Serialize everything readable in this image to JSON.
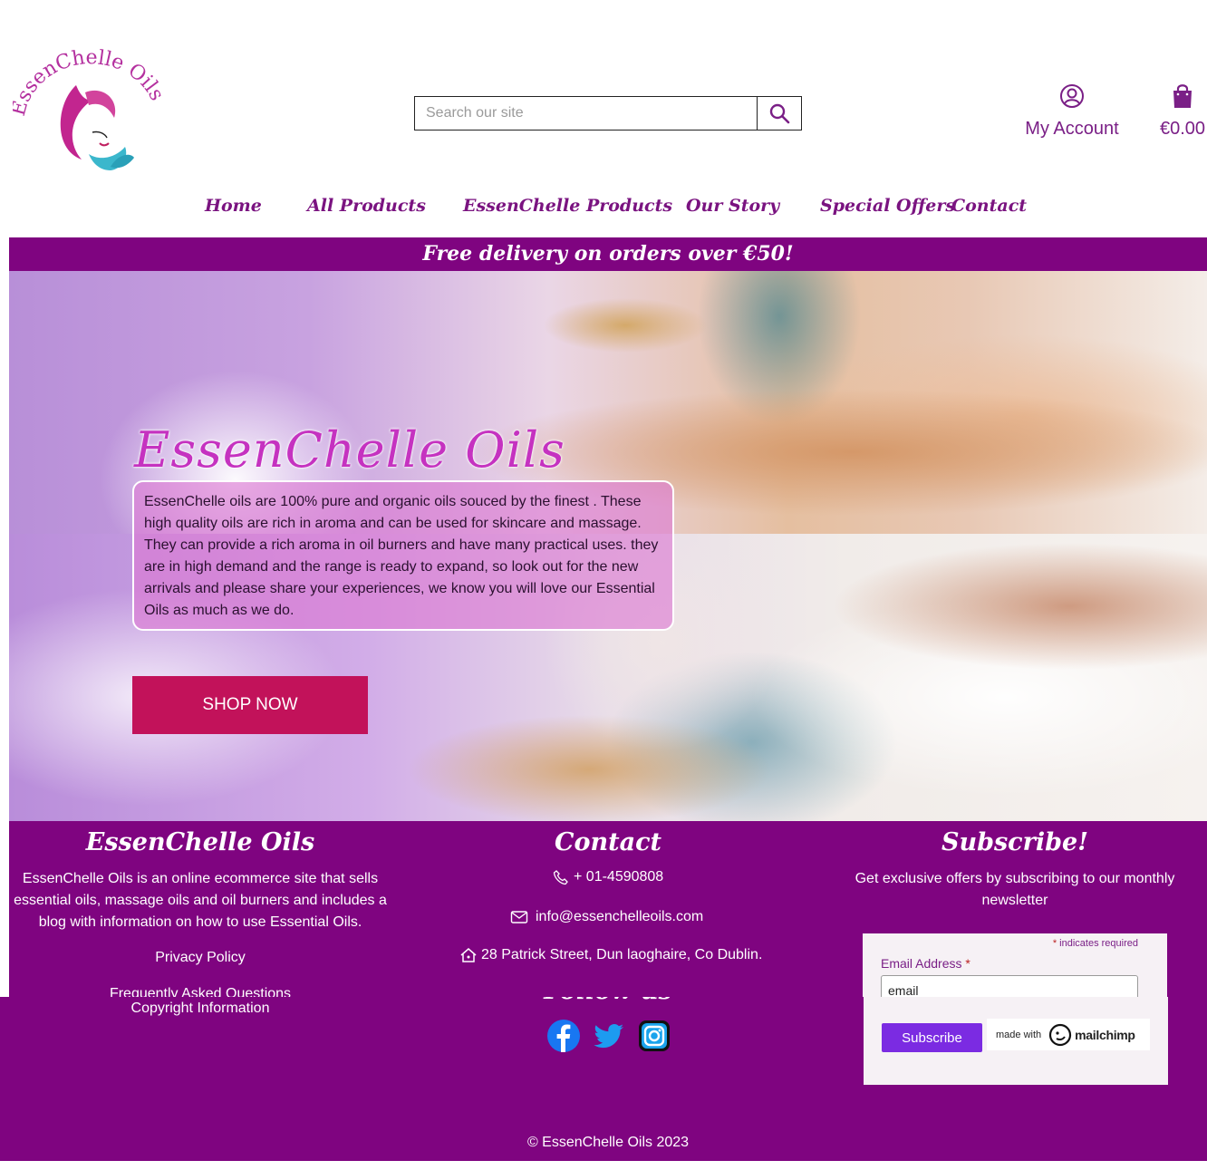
{
  "header": {
    "logo_text": "EssenChelle Oils",
    "search_placeholder": "Search our site",
    "account_label": "My Account",
    "cart_total": "€0.00"
  },
  "nav": {
    "items": [
      {
        "label": "Home"
      },
      {
        "label": "All Products"
      },
      {
        "label": "EssenChelle Products"
      },
      {
        "label": "Our Story"
      },
      {
        "label": "Special Offers"
      },
      {
        "label": "Contact"
      }
    ]
  },
  "banner": {
    "text": "Free delivery on orders over €50!"
  },
  "hero": {
    "title": "EssenChelle Oils",
    "description": "EssenChelle oils are 100% pure and organic oils souced by the finest . These high quality oils are rich in aroma and can be used for skincare and massage. They can provide a rich aroma in oil burners and have many practical uses. they are in high demand and the range is ready to expand, so look out for the new arrivals and please share your experiences, we know you will love our Essential Oils as much as we do.",
    "cta_label": "SHOP NOW"
  },
  "footer": {
    "about_heading": "EssenChelle Oils",
    "about_text": "EssenChelle Oils is an online ecommerce site that sells essential oils, massage oils and oil burners and includes a blog with information on how to use Essential Oils.",
    "privacy_label": "Privacy Policy",
    "faq_label": "Frequently Asked Questions",
    "copyright_info_label": "Copyright Information",
    "contact_heading": "Contact",
    "phone": "+ 01-4590808",
    "email": "info@essenchelleoils.com",
    "address": "28 Patrick Street, Dun laoghaire, Co Dublin.",
    "follow_heading": "Follow us",
    "social": [
      "facebook-icon",
      "twitter-icon",
      "instagram-icon"
    ],
    "subscribe_heading": "Subscribe!",
    "subscribe_text": "Get exclusive offers by subscribing to our monthly newsletter",
    "copyright": "© EssenChelle Oils 2023"
  },
  "mailchimp": {
    "required_note": "indicates required",
    "required_mark": "*",
    "email_label": "Email Address",
    "email_value": "email",
    "subscribe_label": "Subscribe",
    "made_with": "made with",
    "brand": "mailchimp"
  },
  "colors": {
    "brand_purple": "#7f0480",
    "nav_text": "#7a1380",
    "cta": "#c2125a",
    "subscribe_button": "#7b2be2"
  }
}
